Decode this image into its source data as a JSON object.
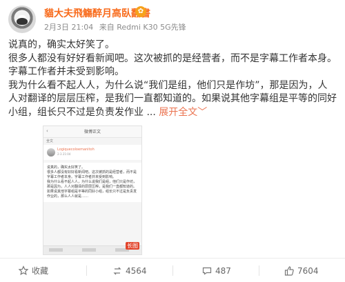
{
  "post": {
    "author": "貓大夫飛觴醉月高臥翻書",
    "author_badge": "✿",
    "meta": {
      "date": "2月3日 21:04",
      "source": "来自 Redmi K30 5G先锋"
    },
    "content": {
      "p1": "说真的，确实太好笑了。",
      "p2": "很多人都没有好好看新闻吧。这次被抓的是经营者，而不是字幕工作者本身。字幕工作者并未受到影响。",
      "p3": "我为什么看不起人人，为什么说“我们是组，他们只是作坊”，那是因为，人人对翻译的层层压榨，是我们一直都知道的。如果说其他字幕组是平等的同好小组，组长只不过是负责发作业",
      "ellipsis": " ... ",
      "expand": "展开全文",
      "expand_chevron": "﹀"
    },
    "thumbnail": {
      "back": "‹",
      "title": "微博正文",
      "section": "全文",
      "user_name": "Logiquecoloemanitoh",
      "user_time": "2-3 21:04",
      "lines": [
        "说真的，确实太好笑了。",
        "很多人都没有好好看新闻吧。这次被抓的是经营者，而不是字幕工作者本身。字幕工作者并未受到影响。",
        "我为什么看不起人人，为什么说我们是组，他们只是作坊，那是因为，人人对翻译的层层压榨，是我们一直都知道的。",
        "如果说其他字幕组是平等的同好小组，组长只不过是负责发作业的，那么人人就是……"
      ],
      "long_image_badge": "长图"
    },
    "actions": {
      "favorite": {
        "label": "收藏",
        "icon": "star-icon"
      },
      "repost": {
        "label": "4564",
        "icon": "repost-icon"
      },
      "comment": {
        "label": "487",
        "icon": "comment-icon"
      },
      "like": {
        "label": "7604",
        "icon": "thumbs-up-icon"
      }
    },
    "colors": {
      "author": "#f86a1a",
      "link": "#eb7350",
      "badge": "#e2442b"
    }
  }
}
